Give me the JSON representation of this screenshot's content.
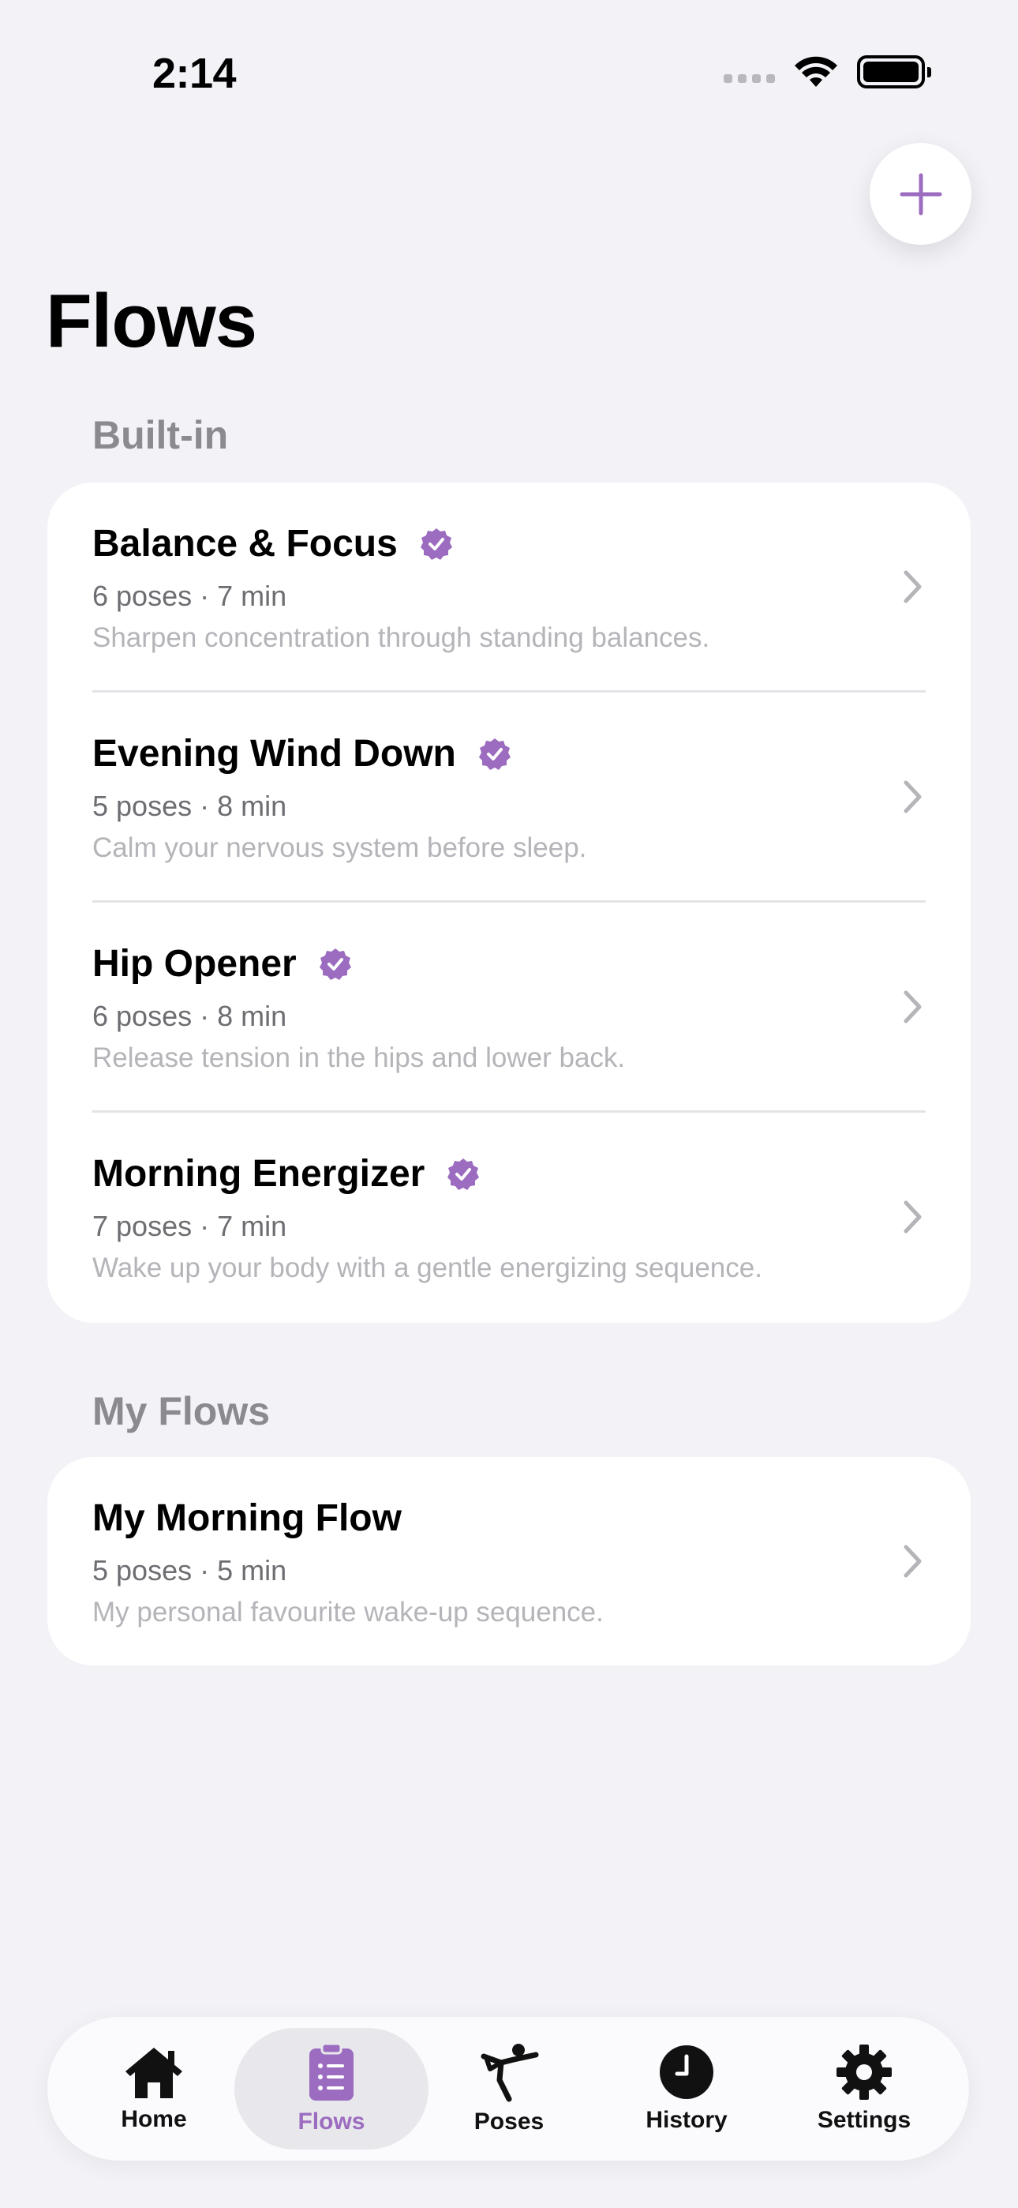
{
  "status_bar": {
    "time": "2:14"
  },
  "header": {
    "title": "Flows"
  },
  "colors": {
    "accent": "#9b6cbf",
    "background": "#f2f2f7",
    "card": "#ffffff"
  },
  "sections": [
    {
      "label": "Built-in",
      "items": [
        {
          "title": "Balance & Focus",
          "meta": "6 poses · 7 min",
          "desc": "Sharpen concentration through standing balances.",
          "badge": "verified-badge-icon"
        },
        {
          "title": "Evening Wind Down",
          "meta": "5 poses · 8 min",
          "desc": "Calm your nervous system before sleep.",
          "badge": "verified-badge-icon"
        },
        {
          "title": "Hip Opener",
          "meta": "6 poses · 8 min",
          "desc": "Release tension in the hips and lower back.",
          "badge": "verified-badge-icon"
        },
        {
          "title": "Morning Energizer",
          "meta": "7 poses · 7 min",
          "desc": "Wake up your body with a gentle energizing sequence.",
          "badge": "verified-badge-icon"
        }
      ]
    },
    {
      "label": "My Flows",
      "items": [
        {
          "title": "My Morning Flow",
          "meta": "5 poses · 5 min",
          "desc": "My personal favourite wake-up sequence."
        }
      ]
    }
  ],
  "tab_bar": {
    "tabs": [
      {
        "label": "Home",
        "icon": "house-icon"
      },
      {
        "label": "Flows",
        "icon": "clipboard-list-icon",
        "active": true
      },
      {
        "label": "Poses",
        "icon": "yoga-pose-icon"
      },
      {
        "label": "History",
        "icon": "clock-icon"
      },
      {
        "label": "Settings",
        "icon": "gear-icon"
      }
    ]
  }
}
